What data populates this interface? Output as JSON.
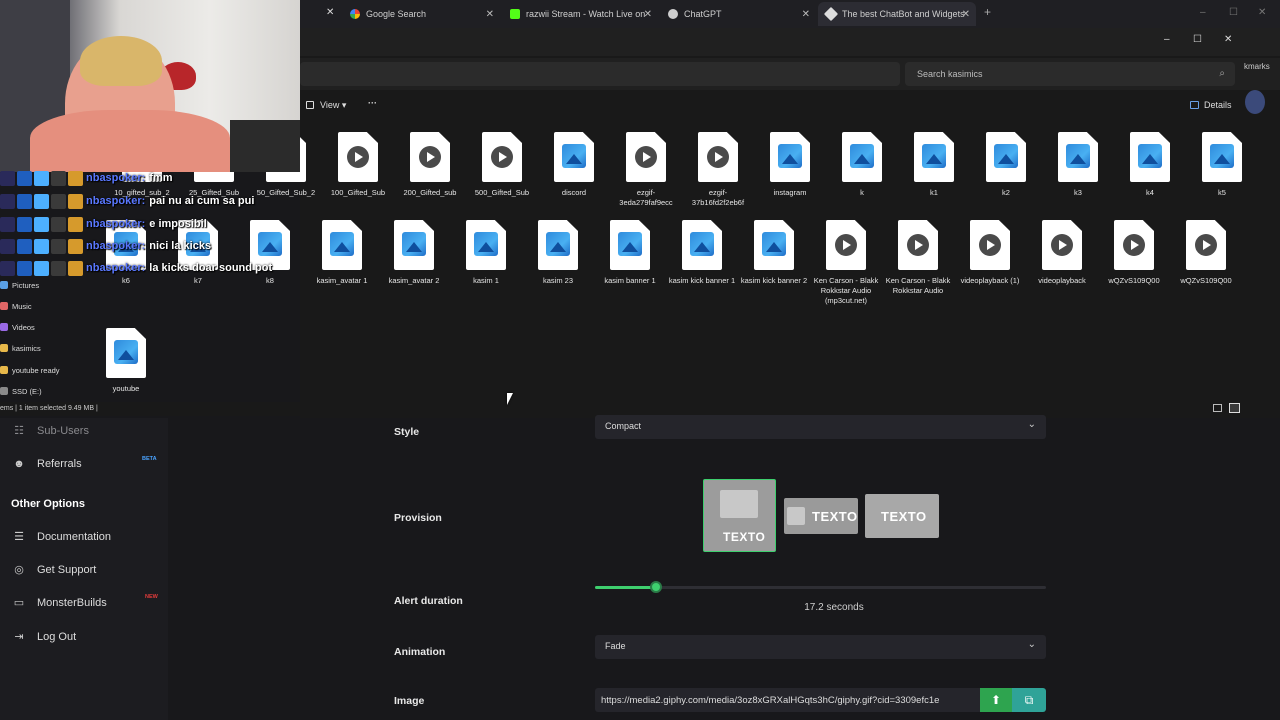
{
  "browser": {
    "tabs": [
      {
        "label": "Google Search"
      },
      {
        "label": "razwii Stream - Watch Live on K"
      },
      {
        "label": "ChatGPT"
      },
      {
        "label": "The best ChatBot and Widgets f"
      }
    ],
    "new_tab": "+",
    "bookmarks_text": "kmarks"
  },
  "explorer": {
    "search_placeholder": "Search kasimics",
    "view_label": "View",
    "more_label": "···",
    "details_label": "Details",
    "win_min": "–",
    "win_max": "☐",
    "win_close": "✕",
    "nav": [
      {
        "label": "Pictures",
        "color": "#5aa0e6"
      },
      {
        "label": "Music",
        "color": "#e06666"
      },
      {
        "label": "Videos",
        "color": "#9a6ae6"
      },
      {
        "label": "kasimics",
        "color": "#e8b84a"
      },
      {
        "label": "youtube ready",
        "color": "#e8b84a"
      },
      {
        "label": "SSD (E:)",
        "color": "#8a8a8a"
      }
    ],
    "files_row1": [
      {
        "name": "10_gifted_sub_2",
        "kind": "video"
      },
      {
        "name": "25_Gifted_Sub",
        "kind": "video"
      },
      {
        "name": "50_Gifted_Sub_2",
        "kind": "video"
      },
      {
        "name": "100_Gifted_Sub",
        "kind": "video"
      },
      {
        "name": "200_Gifted_sub",
        "kind": "video"
      },
      {
        "name": "500_Gifted_Sub",
        "kind": "video"
      },
      {
        "name": "discord",
        "kind": "image"
      },
      {
        "name": "ezgif-3eda279faf9ecc",
        "kind": "video"
      },
      {
        "name": "ezgif-37b16fd2f2eb6f",
        "kind": "video"
      },
      {
        "name": "instagram",
        "kind": "image"
      },
      {
        "name": "k",
        "kind": "image"
      },
      {
        "name": "k1",
        "kind": "image"
      },
      {
        "name": "k2",
        "kind": "image"
      },
      {
        "name": "k3",
        "kind": "image"
      },
      {
        "name": "k4",
        "kind": "image"
      },
      {
        "name": "k5",
        "kind": "image"
      }
    ],
    "files_row2": [
      {
        "name": "k6",
        "kind": "image"
      },
      {
        "name": "k7",
        "kind": "image"
      },
      {
        "name": "k8",
        "kind": "image"
      },
      {
        "name": "kasim_avatar 1",
        "kind": "image"
      },
      {
        "name": "kasim_avatar 2",
        "kind": "image"
      },
      {
        "name": "kasim 1",
        "kind": "image"
      },
      {
        "name": "kasim 23",
        "kind": "image"
      },
      {
        "name": "kasim banner 1",
        "kind": "image"
      },
      {
        "name": "kasim kick banner 1",
        "kind": "image"
      },
      {
        "name": "kasim kick banner 2",
        "kind": "image"
      },
      {
        "name": "Ken Carson - Blakk Rokkstar Audio (mp3cut.net)",
        "kind": "video"
      },
      {
        "name": "Ken Carson - Blakk Rokkstar Audio",
        "kind": "video"
      },
      {
        "name": "videoplayback (1)",
        "kind": "video"
      },
      {
        "name": "videoplayback",
        "kind": "video"
      },
      {
        "name": "wQZvS109Q00",
        "kind": "video"
      },
      {
        "name": "wQZvS109Q00",
        "kind": "video"
      }
    ],
    "files_row3": [
      {
        "name": "youtube",
        "kind": "image"
      }
    ],
    "status": "ems  |  1 item selected  9.49 MB  |"
  },
  "chat": [
    {
      "user": "nbaspoker:",
      "message": "fmm"
    },
    {
      "user": "nbaspoker:",
      "message": "pai nu ai cum sa pui"
    },
    {
      "user": "nbaspoker:",
      "message": "e imposibil"
    },
    {
      "user": "nbaspoker:",
      "message": "nici la kicks"
    },
    {
      "user": "nbaspoker:",
      "message": "la kicks doar sound pot"
    }
  ],
  "dashboard": {
    "sidebar": {
      "sub_users": "Sub-Users",
      "referrals": "Referrals",
      "beta_tag": "BETA",
      "other_options": "Other Options",
      "documentation": "Documentation",
      "get_support": "Get Support",
      "monsterbuilds": "MonsterBuilds",
      "new_tag": "NEW",
      "log_out": "Log Out"
    },
    "style": {
      "label": "Style",
      "value": "Compact"
    },
    "provision": {
      "label": "Provision",
      "options": [
        "TEXTO",
        "TEXTO",
        "TEXTO"
      ],
      "selected_index": 0
    },
    "alert_duration": {
      "label": "Alert duration",
      "value_text": "17.2 seconds",
      "fraction": 0.136
    },
    "animation": {
      "label": "Animation",
      "value": "Fade"
    },
    "image": {
      "label": "Image",
      "value": "https://media2.giphy.com/media/3oz8xGRXalHGqts3hC/giphy.gif?cid=3309efc1e"
    },
    "colors": {
      "accent": "#2ea44f",
      "slider": "#3ecf6e"
    }
  }
}
